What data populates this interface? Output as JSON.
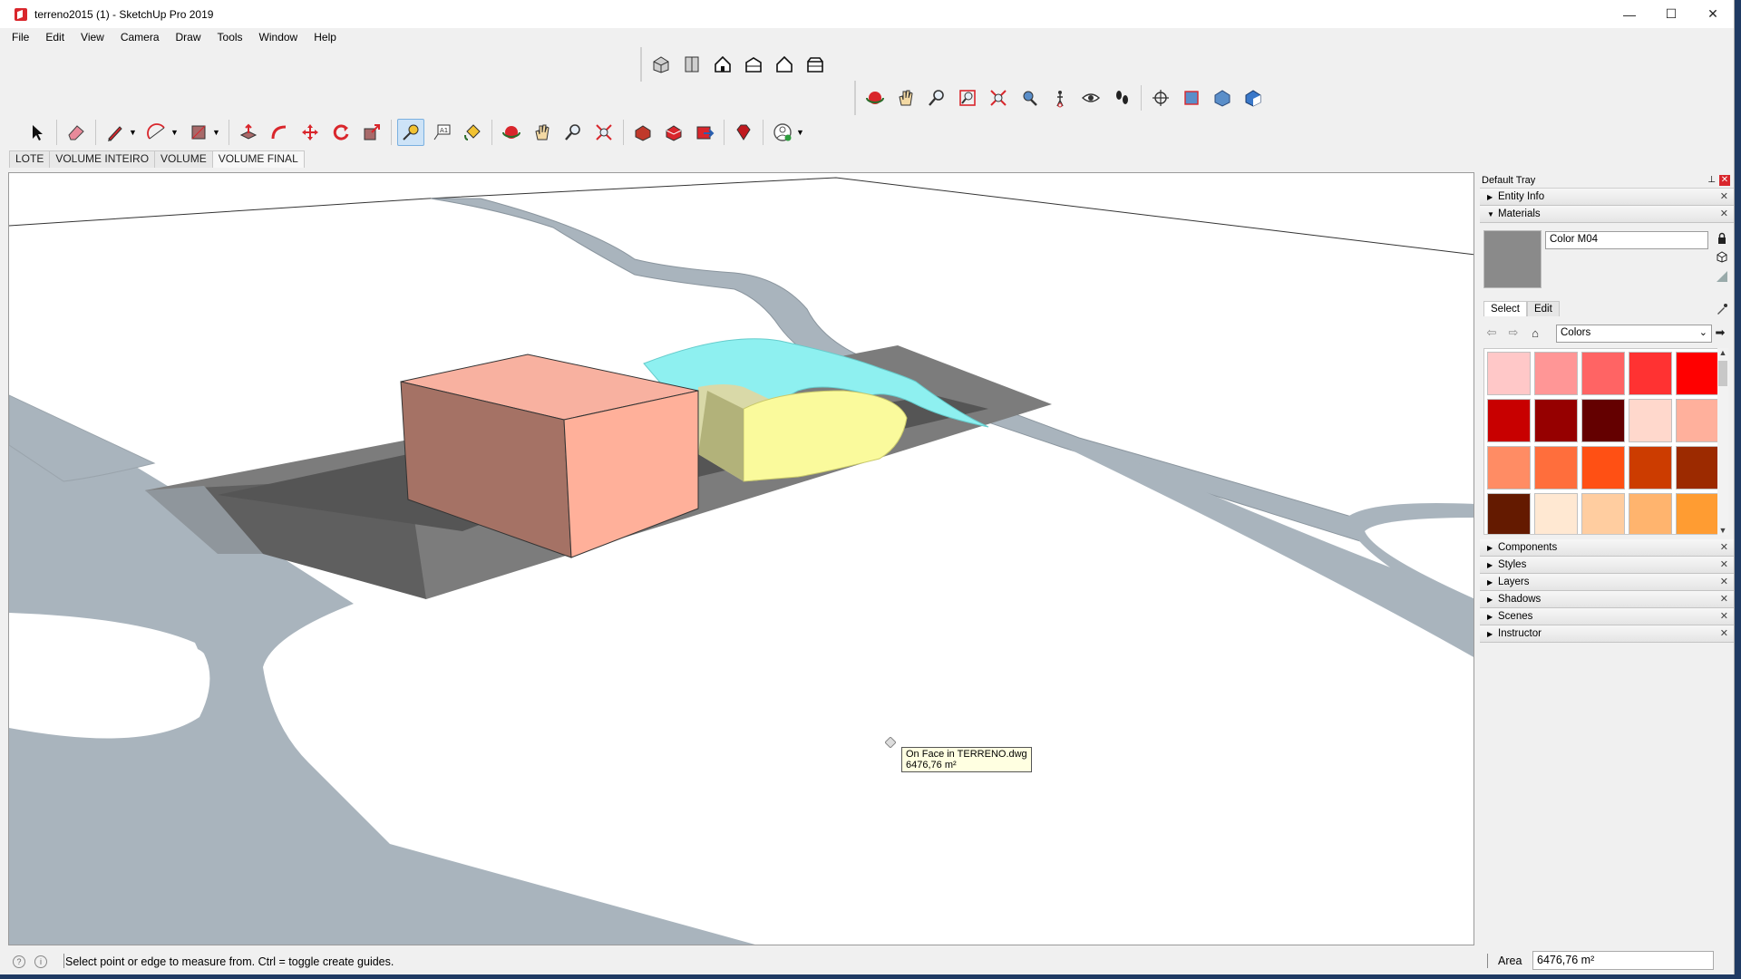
{
  "window": {
    "title": "terreno2015 (1) - SketchUp Pro 2019",
    "minimize": "—",
    "maximize": "☐",
    "close": "✕"
  },
  "menu": [
    "File",
    "Edit",
    "View",
    "Camera",
    "Draw",
    "Tools",
    "Window",
    "Help"
  ],
  "scenes": [
    {
      "label": "LOTE",
      "active": false
    },
    {
      "label": "VOLUME INTEIRO",
      "active": false
    },
    {
      "label": "VOLUME",
      "active": false
    },
    {
      "label": "VOLUME FINAL",
      "active": true
    }
  ],
  "viewport": {
    "tooltip_line1": "On Face in TERRENO.dwg",
    "tooltip_line2": "6476,76 m²"
  },
  "tray": {
    "title": "Default Tray",
    "entity_info": "Entity Info",
    "materials": "Materials",
    "material_name": "Color M04",
    "tab_select": "Select",
    "tab_edit": "Edit",
    "library": "Colors",
    "swatch_colors": [
      "#ffc8c8",
      "#ff9696",
      "#ff6464",
      "#ff3232",
      "#ff0000",
      "#c80000",
      "#960000",
      "#640000",
      "#ffd8cc",
      "#ffb09c",
      "#ff8c64",
      "#ff6e3c",
      "#ff5014",
      "#cc3c00",
      "#9c2a00",
      "#641a00",
      "#ffe8d2",
      "#ffcda0",
      "#ffb46e",
      "#ff9c32"
    ],
    "panels": [
      "Components",
      "Styles",
      "Layers",
      "Shadows",
      "Scenes",
      "Instructor"
    ]
  },
  "status": {
    "message": "Select point or edge to measure from.  Ctrl = toggle create guides.",
    "measure_label": "Area",
    "measure_value": "6476,76 m²"
  }
}
